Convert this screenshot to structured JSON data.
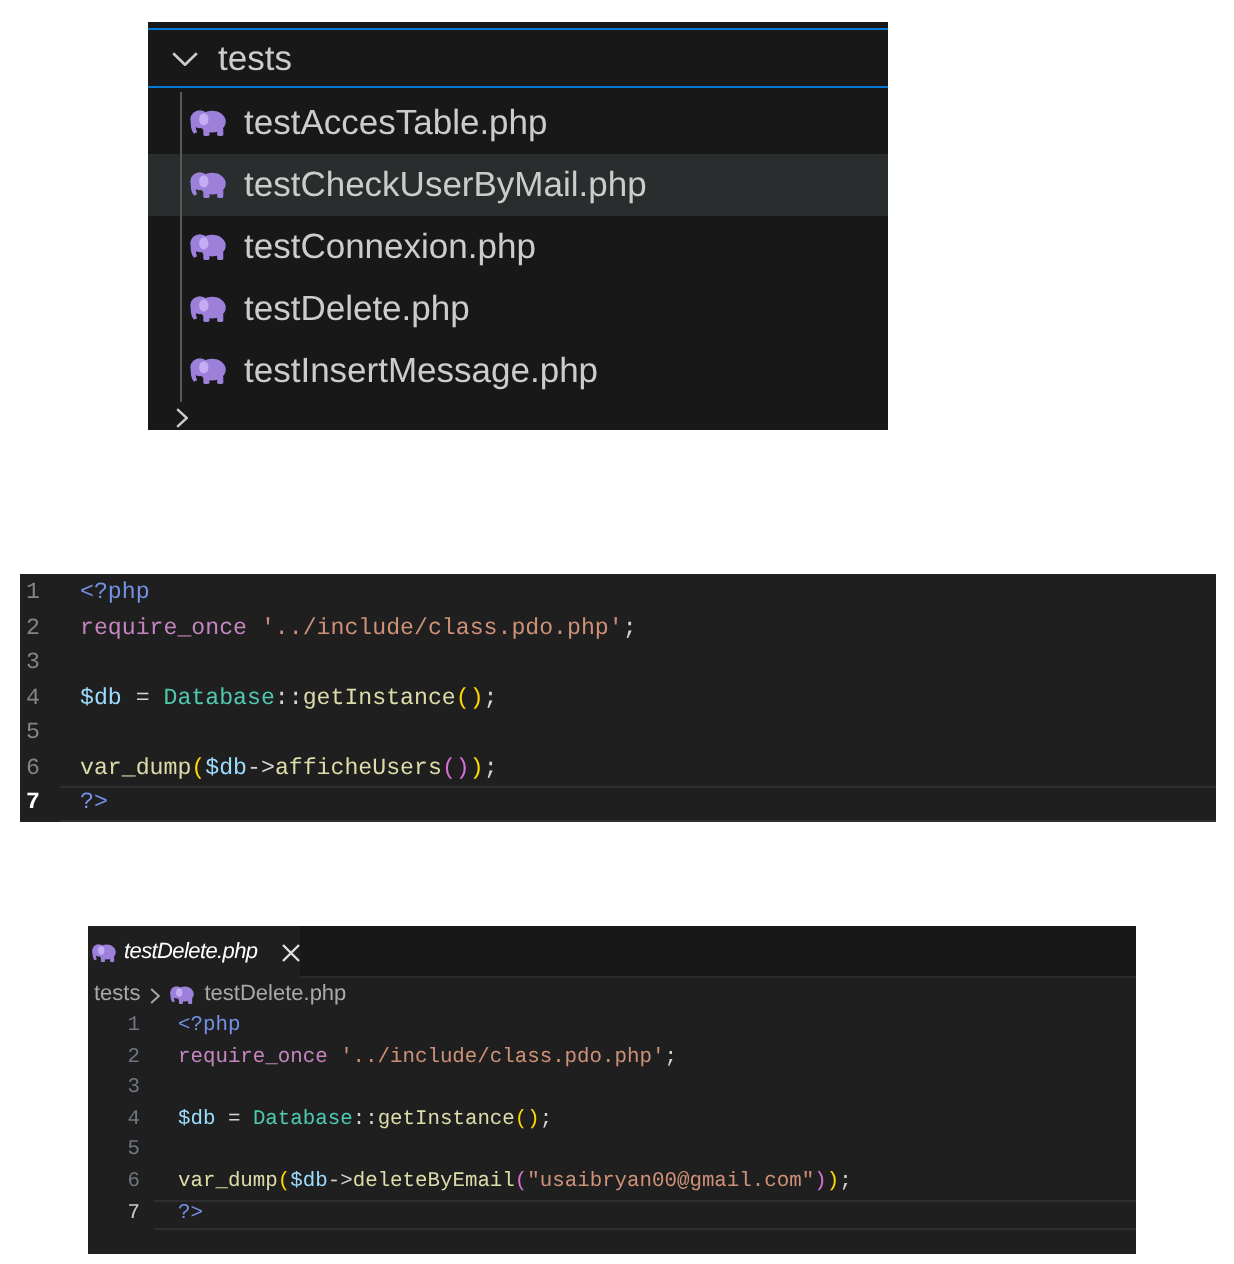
{
  "explorer": {
    "folders": [
      {
        "label": "tests",
        "expanded": true,
        "focused": true,
        "files": [
          {
            "name": "testAccesTable.php",
            "selected": false
          },
          {
            "name": "testCheckUserByMail.php",
            "selected": true
          },
          {
            "name": "testConnexion.php",
            "selected": false
          },
          {
            "name": "testDelete.php",
            "selected": false
          },
          {
            "name": "testInsertMessage.php",
            "selected": false
          }
        ]
      },
      {
        "expanded": false
      }
    ]
  },
  "code_fragment": {
    "lines": [
      {
        "number": "1",
        "current": false,
        "tokens": [
          {
            "kind": "tag",
            "text": "<?php"
          }
        ]
      },
      {
        "number": "2",
        "current": false,
        "tokens": [
          {
            "kind": "keyword",
            "text": "require_once"
          },
          {
            "kind": "string",
            "text": " '../include/class.pdo.php'"
          },
          {
            "kind": "plain",
            "text": ";"
          }
        ]
      },
      {
        "number": "3",
        "current": false
      },
      {
        "number": "4",
        "current": false,
        "tokens": [
          {
            "kind": "variable",
            "text": "$db"
          },
          {
            "kind": "plain",
            "text": " = "
          },
          {
            "kind": "class",
            "text": "Database"
          },
          {
            "kind": "plain",
            "text": "::"
          },
          {
            "kind": "function",
            "text": "getInstance"
          },
          {
            "kind": "bracket1",
            "text": "()"
          },
          {
            "kind": "plain",
            "text": ";"
          }
        ]
      },
      {
        "number": "5",
        "current": false
      },
      {
        "number": "6",
        "current": false,
        "tokens": [
          {
            "kind": "function",
            "text": "var_dump"
          },
          {
            "kind": "bracket1",
            "text": "("
          },
          {
            "kind": "variable",
            "text": "$db"
          },
          {
            "kind": "plain",
            "text": "->"
          },
          {
            "kind": "function",
            "text": "afficheUsers"
          },
          {
            "kind": "bracket2",
            "text": "()"
          },
          {
            "kind": "bracket1",
            "text": ")"
          },
          {
            "kind": "plain",
            "text": ";"
          }
        ]
      },
      {
        "number": "7",
        "current": true,
        "tokens": [
          {
            "kind": "tag",
            "text": "?>"
          }
        ]
      }
    ]
  },
  "editor": {
    "tabs": [
      {
        "label": "testDelete.php",
        "selected": true,
        "preview": true
      }
    ],
    "breadcrumb": [
      {
        "kind": "folder",
        "label": "tests"
      },
      {
        "kind": "file",
        "label": "testDelete.php"
      }
    ],
    "lines": [
      {
        "number": "1",
        "current": false,
        "tokens": [
          {
            "kind": "tag",
            "text": "<?php"
          }
        ]
      },
      {
        "number": "2",
        "current": false,
        "tokens": [
          {
            "kind": "keyword",
            "text": "require_once"
          },
          {
            "kind": "string",
            "text": " '../include/class.pdo.php'"
          },
          {
            "kind": "plain",
            "text": ";"
          }
        ]
      },
      {
        "number": "3",
        "current": false
      },
      {
        "number": "4",
        "current": false,
        "tokens": [
          {
            "kind": "variable",
            "text": "$db"
          },
          {
            "kind": "plain",
            "text": " = "
          },
          {
            "kind": "class",
            "text": "Database"
          },
          {
            "kind": "plain",
            "text": "::"
          },
          {
            "kind": "function",
            "text": "getInstance"
          },
          {
            "kind": "bracket1",
            "text": "()"
          },
          {
            "kind": "plain",
            "text": ";"
          }
        ]
      },
      {
        "number": "5",
        "current": false
      },
      {
        "number": "6",
        "current": false,
        "tokens": [
          {
            "kind": "function",
            "text": "var_dump"
          },
          {
            "kind": "bracket1",
            "text": "("
          },
          {
            "kind": "variable",
            "text": "$db"
          },
          {
            "kind": "plain",
            "text": "->"
          },
          {
            "kind": "function",
            "text": "deleteByEmail"
          },
          {
            "kind": "bracket2",
            "text": "("
          },
          {
            "kind": "string",
            "text": "\"usaibryan00@gmail.com\""
          },
          {
            "kind": "bracket2",
            "text": ")"
          },
          {
            "kind": "bracket1",
            "text": ")"
          },
          {
            "kind": "plain",
            "text": ";"
          }
        ]
      },
      {
        "number": "7",
        "current": true,
        "tokens": [
          {
            "kind": "tag",
            "text": "?>"
          }
        ]
      }
    ]
  }
}
